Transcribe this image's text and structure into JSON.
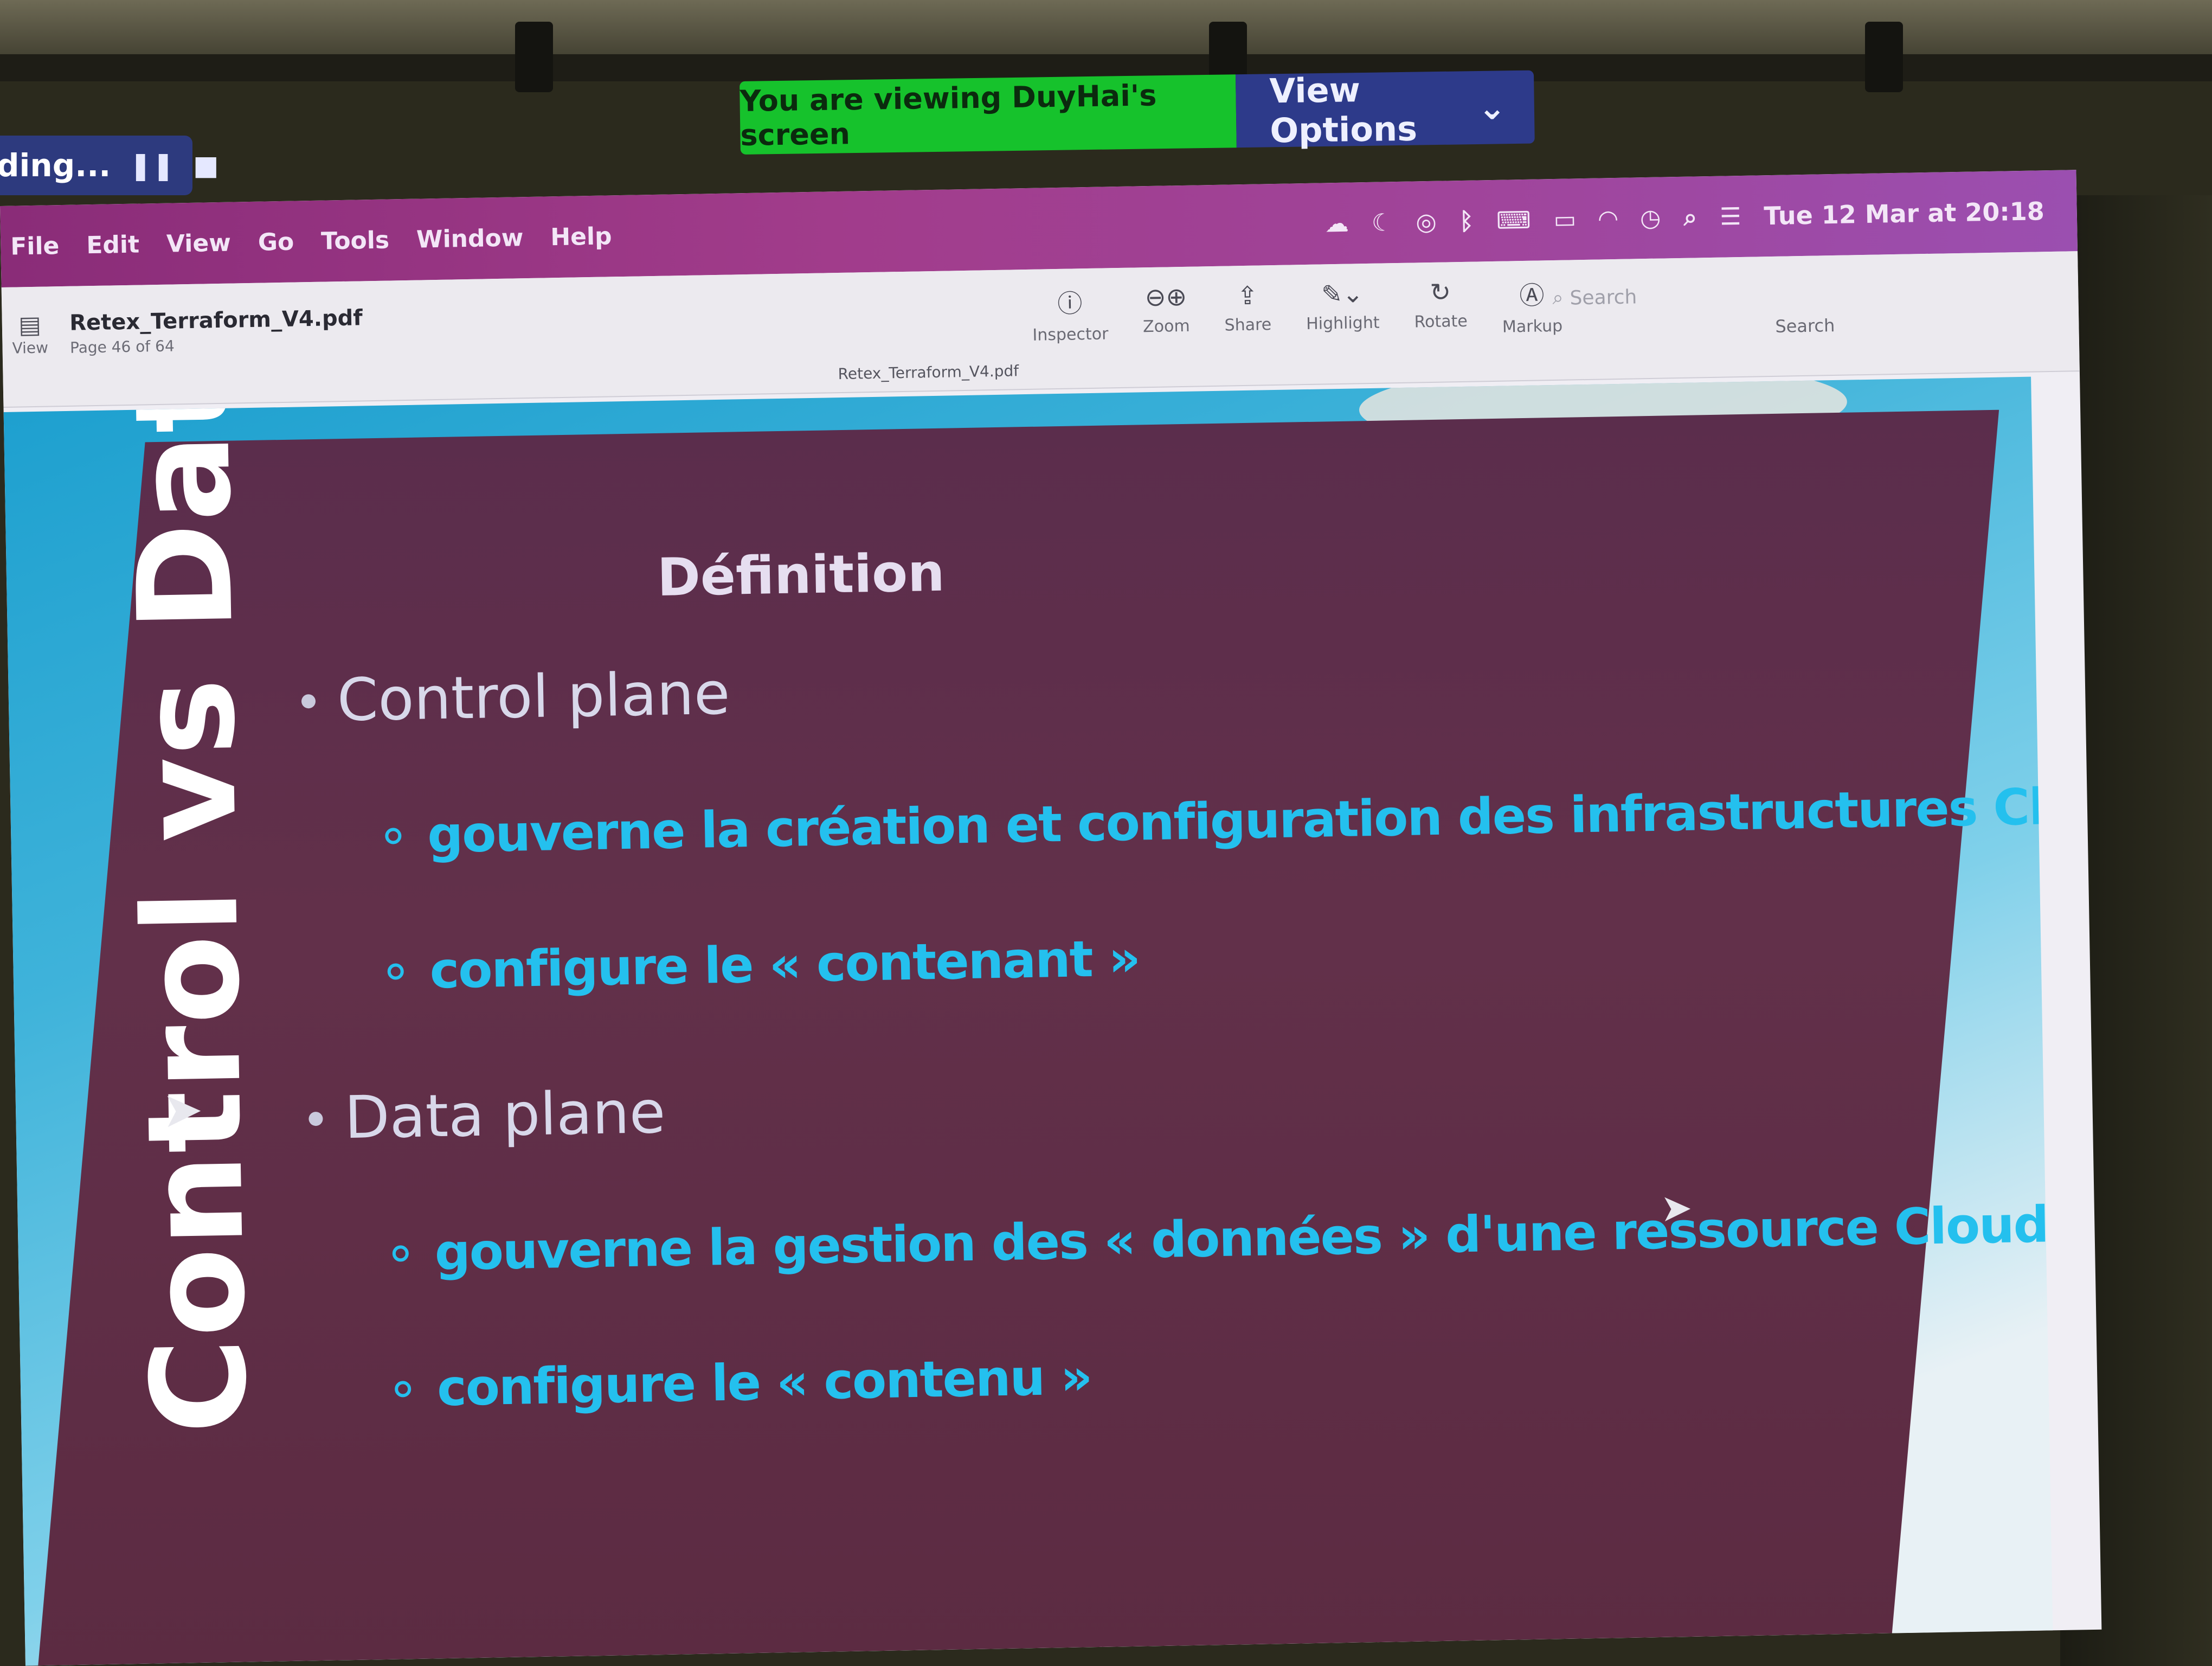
{
  "zoom": {
    "recording_label": "ding...",
    "share_banner": "You are viewing DuyHai's screen",
    "view_options": "View Options"
  },
  "menubar": {
    "items": [
      "File",
      "Edit",
      "View",
      "Go",
      "Tools",
      "Window",
      "Help"
    ],
    "clock": "Tue 12 Mar at 20:18"
  },
  "toolbar": {
    "view_label": "View",
    "doc_title": "Retex_Terraform_V4.pdf",
    "page_info": "Page 46 of 64",
    "tools": [
      "Inspector",
      "Zoom",
      "Share",
      "Highlight",
      "Rotate",
      "Markup"
    ],
    "search_placeholder": "Search",
    "search_label": "Search",
    "tab_title": "Retex_Terraform_V4.pdf"
  },
  "slide": {
    "side_title": "Control vs Data",
    "title": "Définition",
    "sections": [
      {
        "heading": "Control plane",
        "items": [
          "gouverne la création et configuration des infrastructures Cloud",
          "configure le « contenant »"
        ]
      },
      {
        "heading": "Data plane",
        "items": [
          "gouverne la gestion des « données » d'une ressource Cloud",
          "configure le « contenu »"
        ]
      }
    ]
  }
}
